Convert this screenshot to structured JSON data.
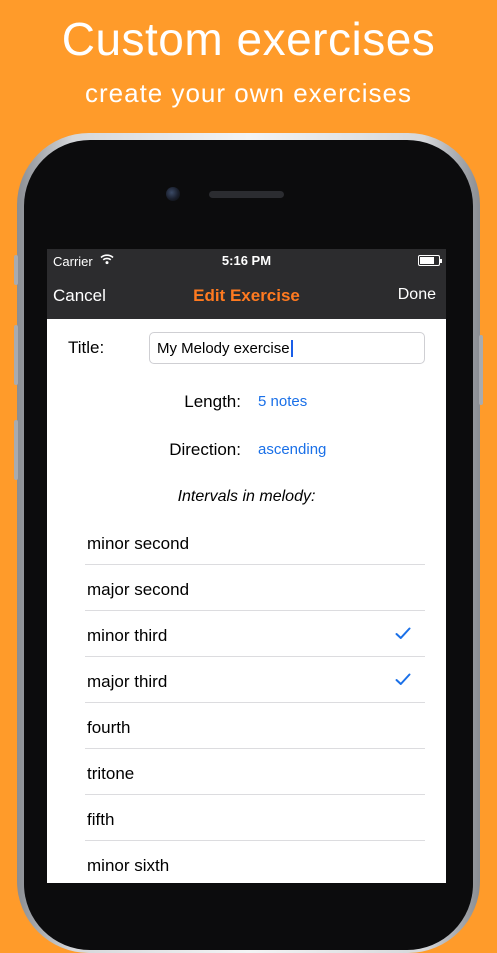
{
  "promo": {
    "headline": "Custom exercises",
    "subheadline": "create your own exercises"
  },
  "status_bar": {
    "carrier": "Carrier",
    "time": "5:16 PM"
  },
  "nav_bar": {
    "cancel_label": "Cancel",
    "title": "Edit Exercise",
    "done_label": "Done"
  },
  "form": {
    "title_label": "Title:",
    "title_value": "My Melody exercise",
    "length_label": "Length:",
    "length_value": "5 notes",
    "direction_label": "Direction:",
    "direction_value": "ascending",
    "intervals_heading": "Intervals in melody:"
  },
  "intervals": [
    {
      "label": "minor second",
      "checked": false
    },
    {
      "label": "major second",
      "checked": false
    },
    {
      "label": "minor third",
      "checked": true
    },
    {
      "label": "major third",
      "checked": true
    },
    {
      "label": "fourth",
      "checked": false
    },
    {
      "label": "tritone",
      "checked": false
    },
    {
      "label": "fifth",
      "checked": false
    },
    {
      "label": "minor sixth",
      "checked": false
    }
  ],
  "colors": {
    "background": "#FF9B2A",
    "accent_orange": "#FF7A20",
    "link_blue": "#1a70e8",
    "bar_dark": "#2c2c2e"
  }
}
